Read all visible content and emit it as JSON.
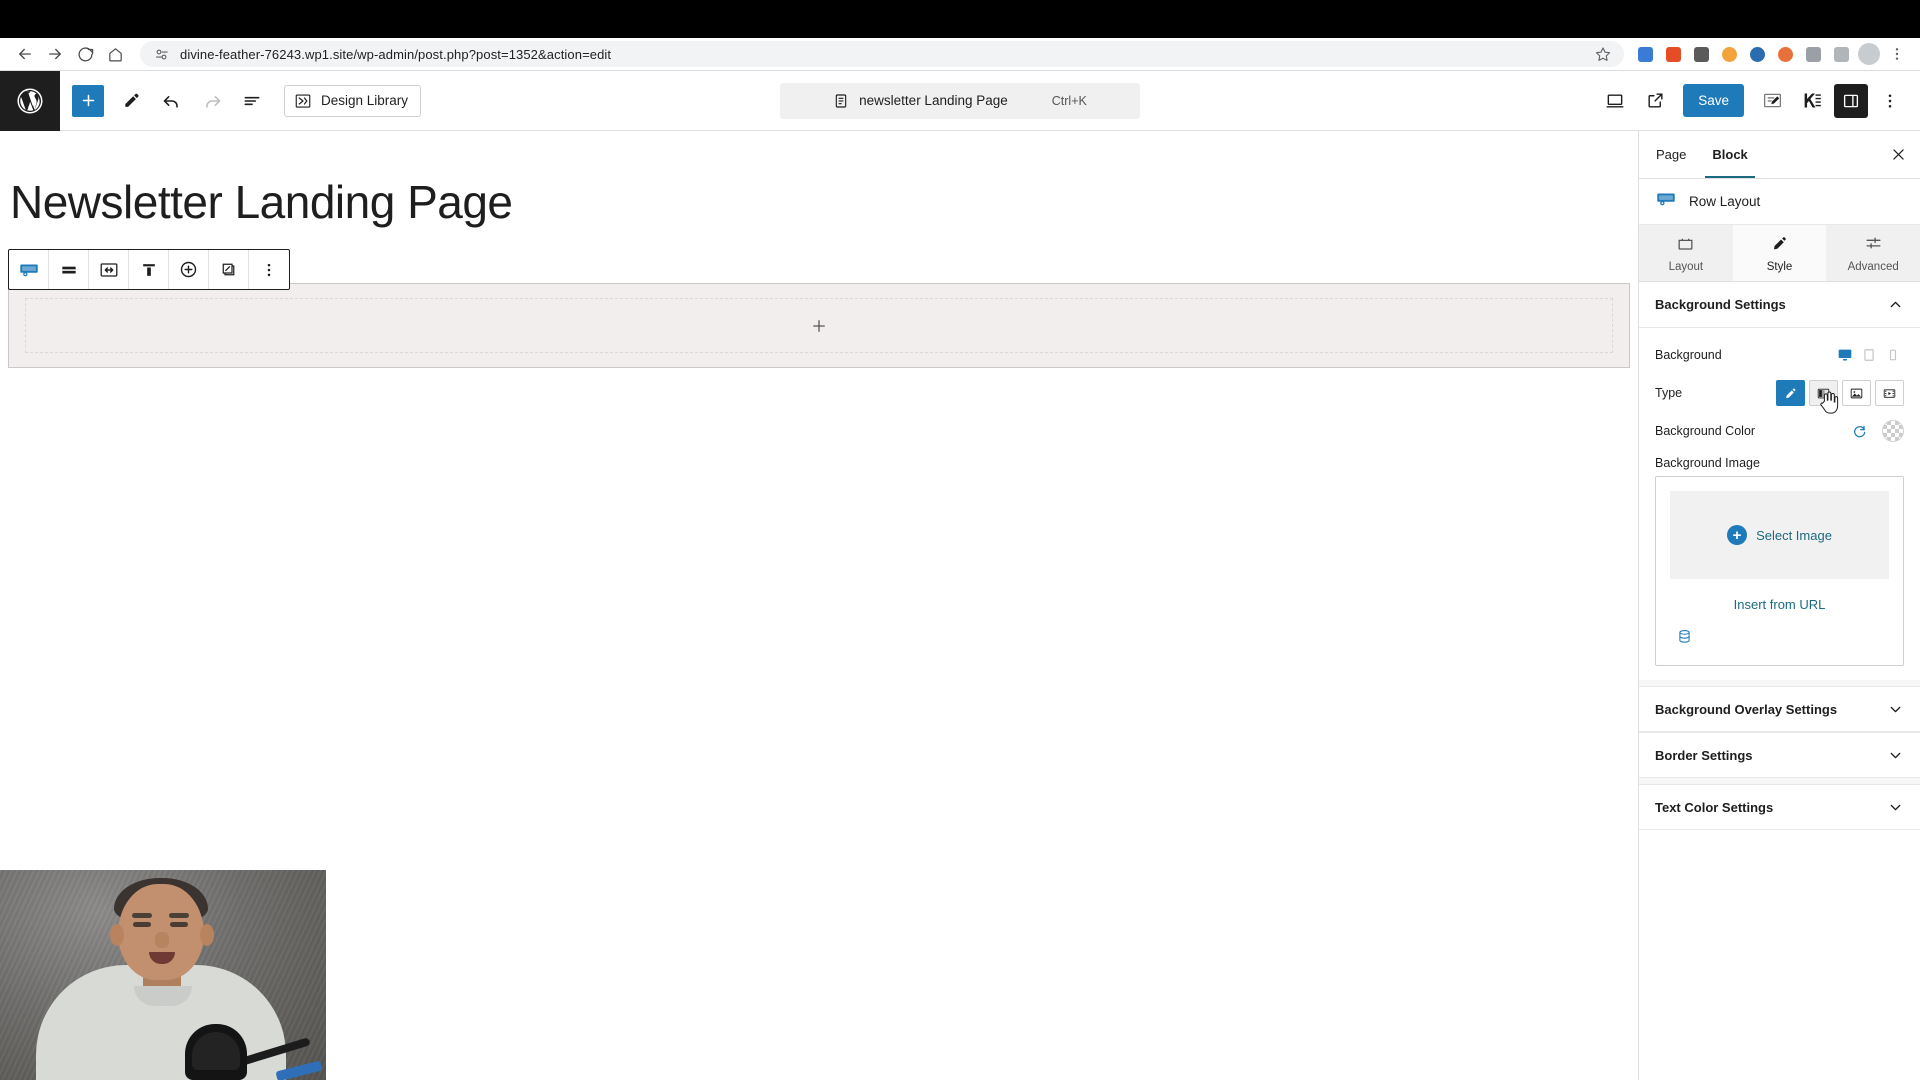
{
  "browser": {
    "back_icon": "arrow-left-icon",
    "forward_icon": "arrow-right-icon",
    "reload_icon": "reload-icon",
    "home_icon": "home-icon",
    "site_info_icon": "site-settings-icon",
    "url": "divine-feather-76243.wp1.site/wp-admin/post.php?post=1352&action=edit",
    "bookmark_icon": "star-icon",
    "extensions": [
      {
        "name": "extension-icon-1",
        "color": "#3a7bd5"
      },
      {
        "name": "extension-icon-2",
        "color": "#e44d26"
      },
      {
        "name": "extension-icon-3",
        "color": "#5a5a5a"
      },
      {
        "name": "extension-icon-4",
        "color": "#f2a33c"
      },
      {
        "name": "extension-icon-5",
        "color": "#2b6cb0"
      },
      {
        "name": "extension-icon-6",
        "color": "#e8703a"
      },
      {
        "name": "extension-icon-7",
        "color": "#777777"
      },
      {
        "name": "extension-icon-8",
        "color": "#888888"
      },
      {
        "name": "profile-avatar",
        "color": "#c7ccd1"
      },
      {
        "name": "browser-menu-icon",
        "color": "#5f6368"
      }
    ]
  },
  "editor_header": {
    "logo_icon": "wordpress-logo-icon",
    "add_block_label": "+",
    "add_block_icon": "plus-icon",
    "tools_icon": "pencil-icon",
    "undo_icon": "undo-icon",
    "redo_icon": "redo-icon",
    "list_view_icon": "list-view-icon",
    "design_library_label": "Design Library",
    "design_library_icon": "kadence-design-library-icon",
    "document_icon": "document-icon",
    "document_title": "newsletter Landing Page",
    "command_shortcut": "Ctrl+K",
    "preview_icon": "device-preview-icon",
    "view_site_icon": "external-link-icon",
    "save_label": "Save",
    "post_edit_icon": "edit-post-icon",
    "kadence_icon": "kadence-icon",
    "settings_sidebar_icon": "settings-sidebar-icon",
    "options_icon": "kebab-menu-icon"
  },
  "canvas": {
    "post_title": "Newsletter Landing Page",
    "block_toolbar": [
      {
        "name": "row-layout-block-icon",
        "label": "Row Layout"
      },
      {
        "name": "align-icon",
        "label": "Change alignment"
      },
      {
        "name": "full-width-icon",
        "label": "Change width"
      },
      {
        "name": "vertical-align-icon",
        "label": "Vertical align"
      },
      {
        "name": "add-column-icon",
        "label": "Add"
      },
      {
        "name": "duplicate-pattern-icon",
        "label": "Pattern"
      },
      {
        "name": "block-options-icon",
        "label": "Options"
      }
    ],
    "row_appender_icon": "plus-icon",
    "webcam_overlay": "presenter-webcam-video"
  },
  "sidebar": {
    "tabs": [
      {
        "label": "Page",
        "active": false
      },
      {
        "label": "Block",
        "active": true
      }
    ],
    "close_icon": "close-icon",
    "block_name": "Row Layout",
    "block_icon": "row-layout-block-icon",
    "mode_tabs": [
      {
        "label": "Layout",
        "icon": "layout-box-icon",
        "active": false
      },
      {
        "label": "Style",
        "icon": "paint-brush-icon",
        "active": true
      },
      {
        "label": "Advanced",
        "icon": "sliders-icon",
        "active": false
      }
    ],
    "panels": [
      {
        "title": "Background Settings",
        "expanded": true
      },
      {
        "title": "Background Overlay Settings",
        "expanded": false
      },
      {
        "title": "Border Settings",
        "expanded": false
      },
      {
        "title": "Text Color Settings",
        "expanded": false
      }
    ],
    "background": {
      "label": "Background",
      "devices": [
        {
          "name": "desktop-icon",
          "active": true
        },
        {
          "name": "tablet-icon",
          "active": false
        },
        {
          "name": "mobile-icon",
          "active": false
        }
      ],
      "type_label": "Type",
      "types": [
        {
          "name": "color-type-button",
          "icon": "paint-brush-icon",
          "active": true
        },
        {
          "name": "gradient-type-button",
          "icon": "gradient-icon",
          "active": false,
          "hovered": true
        },
        {
          "name": "image-type-button",
          "icon": "image-icon",
          "active": false
        },
        {
          "name": "video-type-button",
          "icon": "video-icon",
          "active": false
        }
      ],
      "color_label": "Background Color",
      "color_reset_icon": "reset-icon",
      "color_value": "transparent",
      "image_label": "Background Image",
      "select_image_label": "Select Image",
      "select_image_icon": "plus-circle-icon",
      "insert_from_url_label": "Insert from URL",
      "media_library_icon": "media-library-icon"
    }
  },
  "colors": {
    "accent_blue": "#1e7ab8",
    "tab_underline": "#1b6a80",
    "link_blue": "#1b6a80",
    "dark": "#1e1e1e",
    "row_block_bg": "#f2eeee"
  }
}
